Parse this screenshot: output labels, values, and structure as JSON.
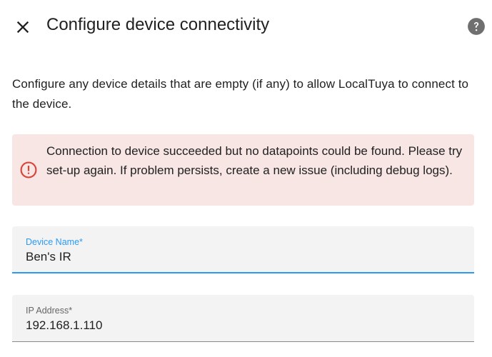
{
  "dialog": {
    "title": "Configure device connectivity",
    "close_icon": "close-icon",
    "help_icon": "help-circle-icon"
  },
  "description": "Configure any device details that are empty (if any) to allow LocalTuya to connect to the device.",
  "alert": {
    "type": "error",
    "icon": "alert-circle-icon",
    "message": "Connection to device succeeded but no datapoints could be found. Please try set-up again. If problem persists, create a new issue (including debug logs)."
  },
  "fields": {
    "device_name": {
      "label": "Device Name*",
      "value": "Ben's IR"
    },
    "ip_address": {
      "label": "IP Address*",
      "value": "192.168.1.110"
    }
  },
  "colors": {
    "accent": "#2b9af3",
    "error": "#db4437",
    "error_background": "#f8e6e5",
    "field_background": "#f3f3f3"
  }
}
